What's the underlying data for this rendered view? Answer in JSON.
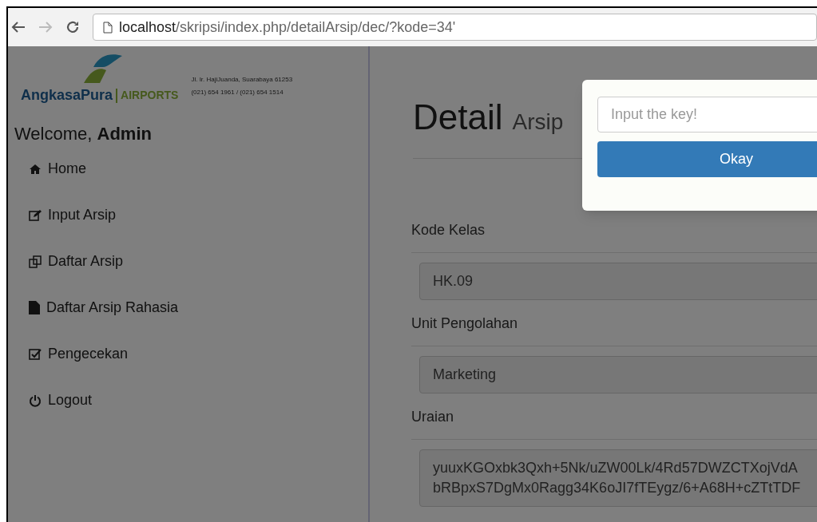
{
  "browser": {
    "url_host": "localhost",
    "url_path": "/skripsi/index.php/detailArsip/dec/?kode=34'"
  },
  "header": {
    "logo_word": "AngkasaPura",
    "logo_suffix": "AIRPORTS",
    "address": "Jl. Ir. HajiJuanda, Suarabaya 61253",
    "phone": "(021) 654 1961 / (021) 654 1514"
  },
  "welcome": {
    "greeting": "Welcome,",
    "user": "Admin"
  },
  "sidebar": {
    "items": [
      {
        "kind": "home",
        "label": "Home"
      },
      {
        "kind": "edit",
        "label": "Input Arsip"
      },
      {
        "kind": "copy",
        "label": "Daftar Arsip"
      },
      {
        "kind": "file",
        "label": "Daftar Arsip Rahasia"
      },
      {
        "kind": "check",
        "label": "Pengecekan"
      },
      {
        "kind": "power",
        "label": "Logout"
      }
    ]
  },
  "page": {
    "title": "Detail",
    "subtitle": "Arsip"
  },
  "fields": [
    {
      "label": "Kode Kelas",
      "lines": [
        "HK.09"
      ]
    },
    {
      "label": "Unit Pengolahan",
      "lines": [
        "Marketing"
      ]
    },
    {
      "label": "Uraian",
      "lines": [
        "yuuxKGOxbk3Qxh+5Nk/uZW00Lk/4Rd57DWZCTXojVdA",
        "bRBpxS7DgMx0Ragg34K6oJI7fTEygz/6+A68H+cZTtTDF"
      ]
    }
  ],
  "dialog": {
    "placeholder": "Input the key!",
    "button": "Okay"
  }
}
